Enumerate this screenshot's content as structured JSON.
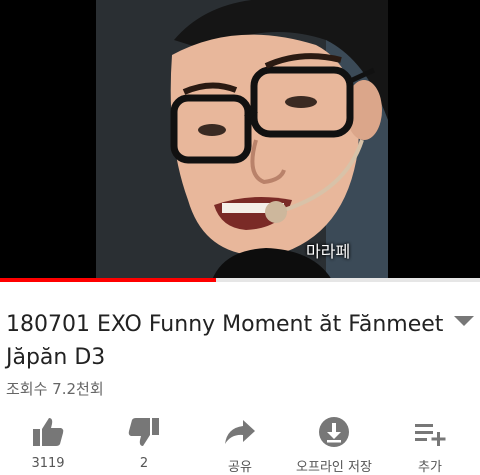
{
  "video": {
    "caption": "마라페"
  },
  "progress": {
    "fraction": 0.45
  },
  "info": {
    "title": "180701 EXO Funny Moment ăt Făn­meet Jăpăn D3",
    "views": "조회수 7.2천회"
  },
  "actions": {
    "like": {
      "icon": "thumbs-up-icon",
      "label": "3119"
    },
    "dislike": {
      "icon": "thumbs-down-icon",
      "label": "2"
    },
    "share": {
      "icon": "share-icon",
      "label": "공유"
    },
    "download": {
      "icon": "download-icon",
      "label": "오프라인 저장"
    },
    "add": {
      "icon": "add-to-playlist-icon",
      "label": "추가"
    }
  }
}
